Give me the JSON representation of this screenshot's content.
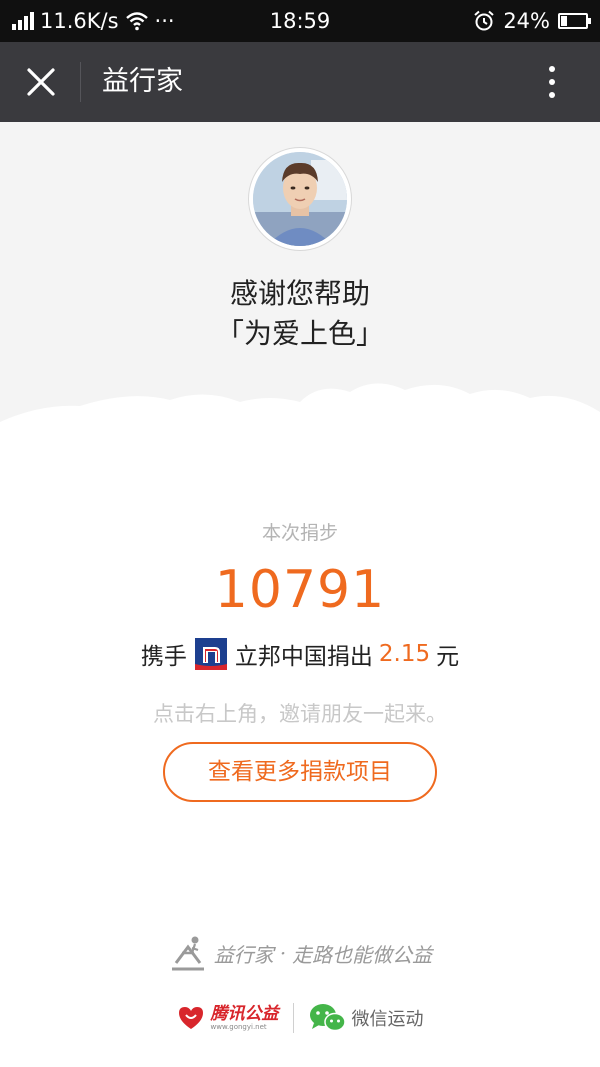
{
  "status_bar": {
    "net_speed": "11.6K/s",
    "dots": "···",
    "time": "18:59",
    "battery_percent": "24%",
    "battery_level": 0.24
  },
  "title_bar": {
    "title": "益行家"
  },
  "hero": {
    "thanks_line1": "感谢您帮助",
    "thanks_line2": "「为爱上色」"
  },
  "donation": {
    "steps_label": "本次捐步",
    "steps_value": "10791",
    "prefix": "携手",
    "brand": "立邦中国捐出",
    "amount": "2.15",
    "unit": "元"
  },
  "invite_hint": "点击右上角，邀请朋友一起来。",
  "more_projects_label": "查看更多捐款项目",
  "footer": {
    "slogan_brand": "益行家",
    "slogan_dot": "·",
    "slogan_text": "走路也能做公益",
    "tencent_charity": "腾讯公益",
    "tencent_url": "www.gongyi.net",
    "wechat_sports": "微信运动"
  },
  "colors": {
    "accent": "#ef6a1f",
    "title_bar_bg": "#3a3a3e",
    "status_bar_bg": "#101010",
    "hero_bg": "#f4f4f4"
  }
}
